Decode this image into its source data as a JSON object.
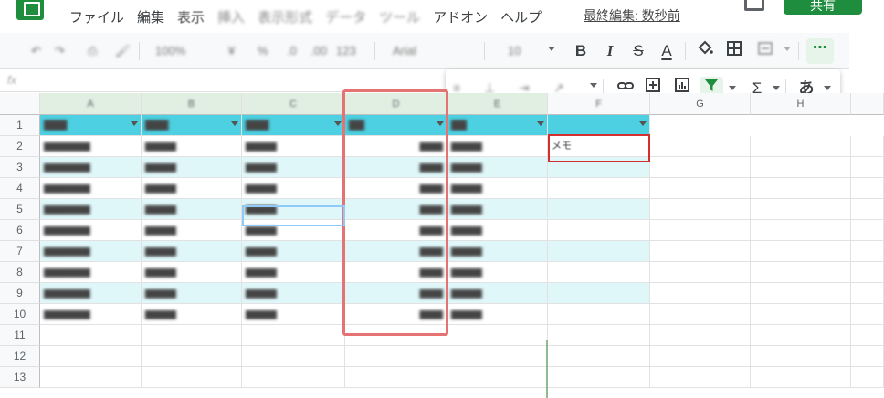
{
  "menubar": {
    "items": [
      {
        "label": "ファイル",
        "blurred": false
      },
      {
        "label": "編集",
        "blurred": false
      },
      {
        "label": "表示",
        "blurred": false
      },
      {
        "label": "挿入",
        "blurred": true
      },
      {
        "label": "表示形式",
        "blurred": true
      },
      {
        "label": "データ",
        "blurred": true
      },
      {
        "label": "ツール",
        "blurred": true
      },
      {
        "label": "アドオン",
        "blurred": false
      },
      {
        "label": "ヘルプ",
        "blurred": false
      }
    ],
    "last_edit": "最終編集: 数秒前",
    "share_label": "共有"
  },
  "toolbar": {
    "undo_icon": "undo-icon",
    "redo_icon": "redo-icon",
    "zoom": "100%",
    "currency": "¥",
    "percent": "%",
    "format_more": "123",
    "font": "Arial",
    "font_size": "10",
    "bold": "B",
    "italic": "I",
    "strike": "S",
    "text_color": "A",
    "more": "⋯"
  },
  "overflow": {
    "functions": "Σ",
    "input_tool": "あ"
  },
  "formula": {
    "fx": "fx",
    "value": " "
  },
  "columns": [
    "A",
    "B",
    "C",
    "D",
    "E",
    "F",
    "G",
    "H"
  ],
  "rows": [
    "1",
    "2",
    "3",
    "4",
    "5",
    "6",
    "7",
    "8",
    "9",
    "10",
    "11",
    "12",
    "13"
  ],
  "cell_g2": "メモ",
  "colors": {
    "header_fill": "#4dd0e1",
    "band_fill": "#e0f7fa",
    "highlight": "#e57373",
    "accent_green": "#1e8e3e"
  }
}
